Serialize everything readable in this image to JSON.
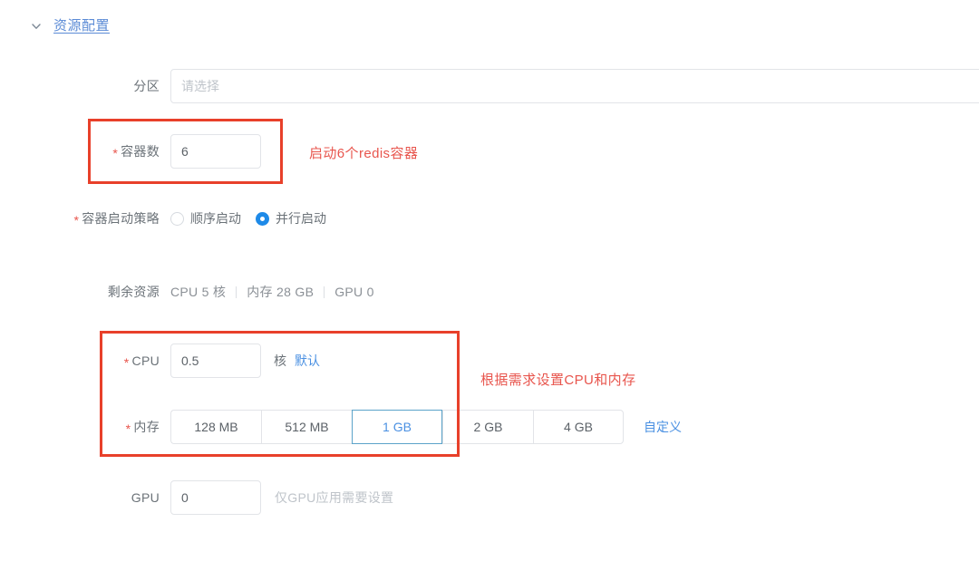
{
  "section": {
    "title": "资源配置",
    "chevron_icon": "chevron-down-icon",
    "expanded": true,
    "link_color": "#5b8bd6"
  },
  "form": {
    "partition": {
      "label": "分区",
      "required": false,
      "placeholder": "请选择",
      "value": ""
    },
    "container_count": {
      "label": "容器数",
      "required": true,
      "required_mark": "*",
      "value": "6"
    },
    "start_policy": {
      "label": "容器启动策略",
      "required": true,
      "required_mark": "*",
      "options": [
        {
          "label": "顺序启动",
          "selected": false
        },
        {
          "label": "并行启动",
          "selected": true
        }
      ],
      "selected_color": "#1e8ae8"
    },
    "remaining": {
      "label": "剩余资源",
      "items": [
        "CPU 5 核",
        "内存 28 GB",
        "GPU 0"
      ]
    },
    "cpu": {
      "label": "CPU",
      "required": true,
      "required_mark": "*",
      "value": "0.5",
      "unit": "核",
      "link": "默认"
    },
    "memory": {
      "label": "内存",
      "required": true,
      "required_mark": "*",
      "options": [
        {
          "label": "128 MB",
          "selected": false
        },
        {
          "label": "512 MB",
          "selected": false
        },
        {
          "label": "1 GB",
          "selected": true
        },
        {
          "label": "2 GB",
          "selected": false
        },
        {
          "label": "4 GB",
          "selected": false
        }
      ],
      "link": "自定义"
    },
    "gpu": {
      "label": "GPU",
      "required": false,
      "value": "0",
      "hint": "仅GPU应用需要设置"
    }
  },
  "annotations": {
    "box_color": "#e8402a",
    "text_color": "#e8554d",
    "container_count_note": "启动6个redis容器",
    "cpu_memory_note": "根据需求设置CPU和内存"
  }
}
